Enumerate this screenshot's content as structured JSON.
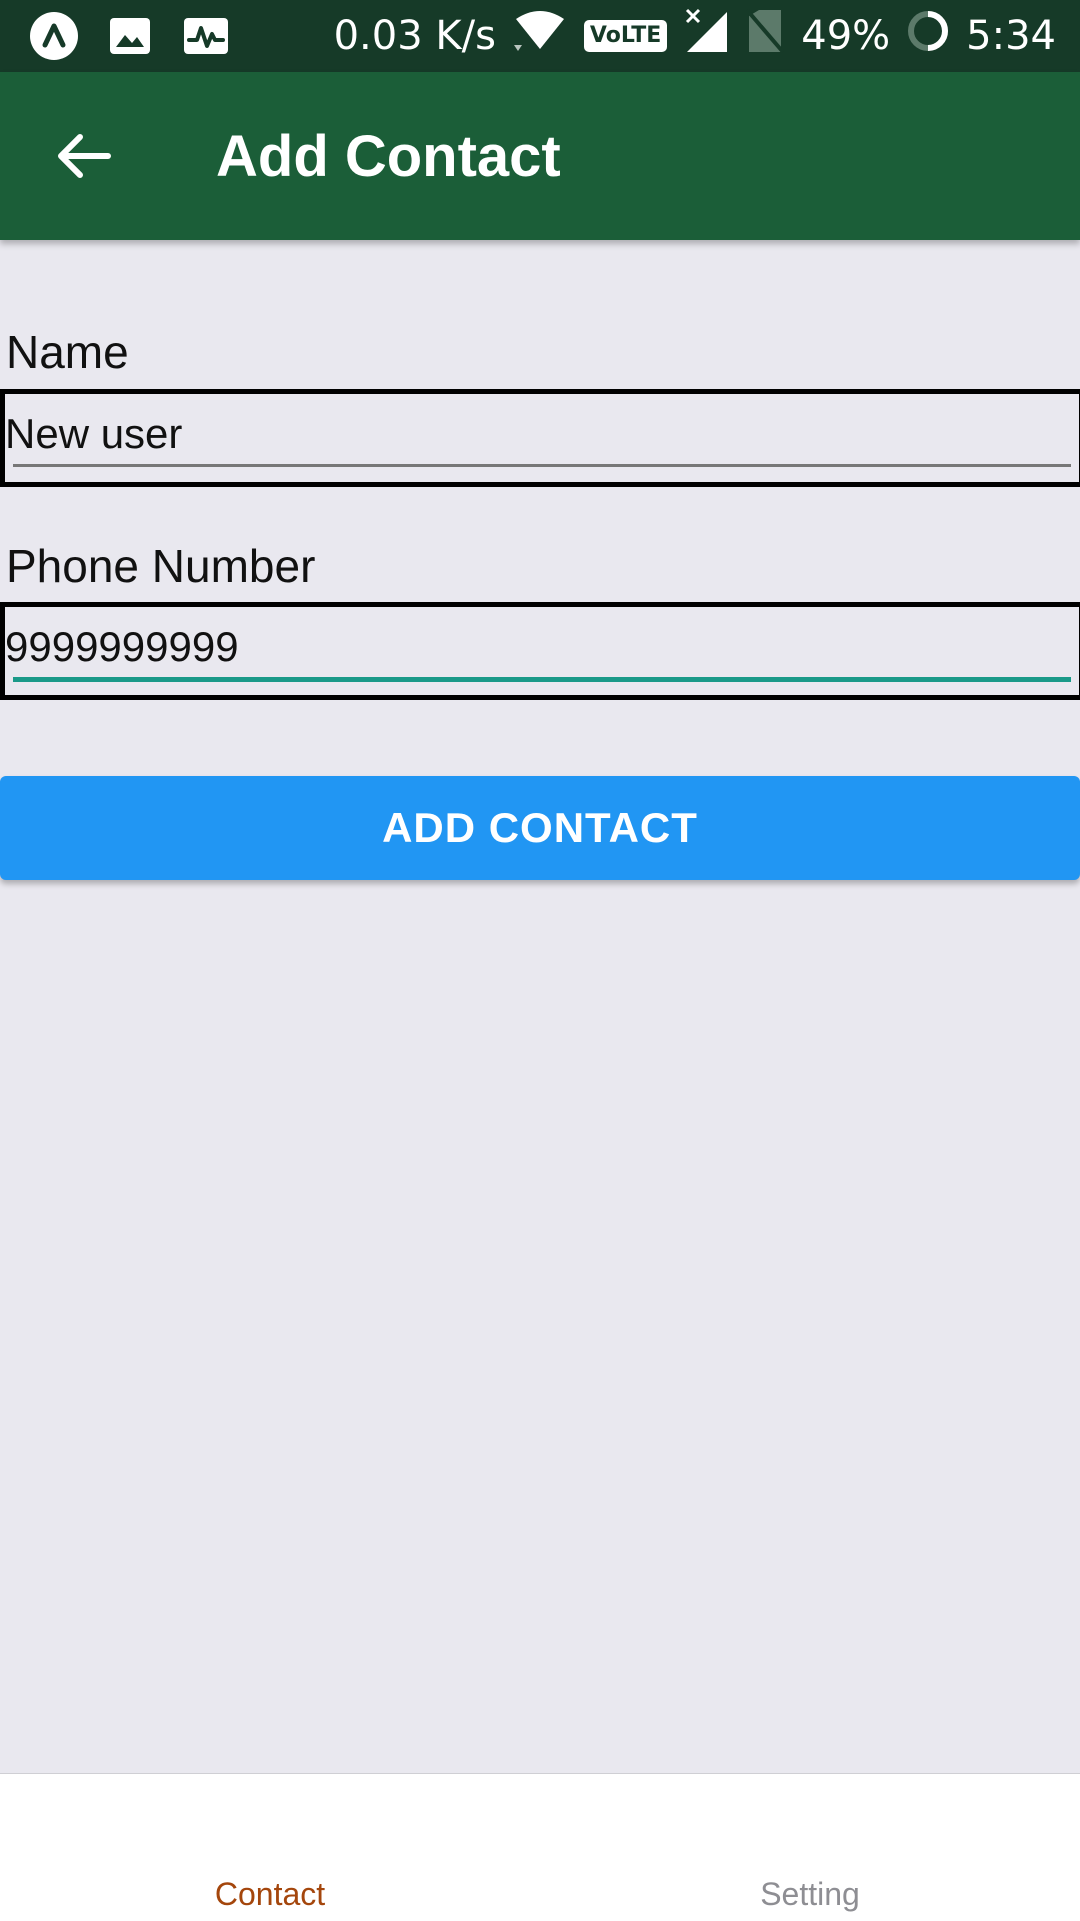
{
  "status_bar": {
    "net_speed": "0.03 K/s",
    "volte": "VoLTE",
    "battery": "49%",
    "time": "5:34"
  },
  "app_bar": {
    "title": "Add Contact"
  },
  "form": {
    "name_label": "Name",
    "name_value": "New user",
    "phone_label": "Phone Number",
    "phone_value": "9999999999"
  },
  "add_button_label": "ADD CONTACT",
  "tabs": [
    {
      "label": "Contact",
      "active": true
    },
    {
      "label": "Setting",
      "active": false
    }
  ],
  "colors": {
    "status_bar": "#163a28",
    "app_bar": "#1b5e38",
    "background": "#e9e8ef",
    "button": "#2196f3",
    "active_tab": "#a4460c",
    "inactive_tab": "#8e8e93",
    "focused_underline": "#1a9988",
    "idle_underline": "#777777"
  }
}
